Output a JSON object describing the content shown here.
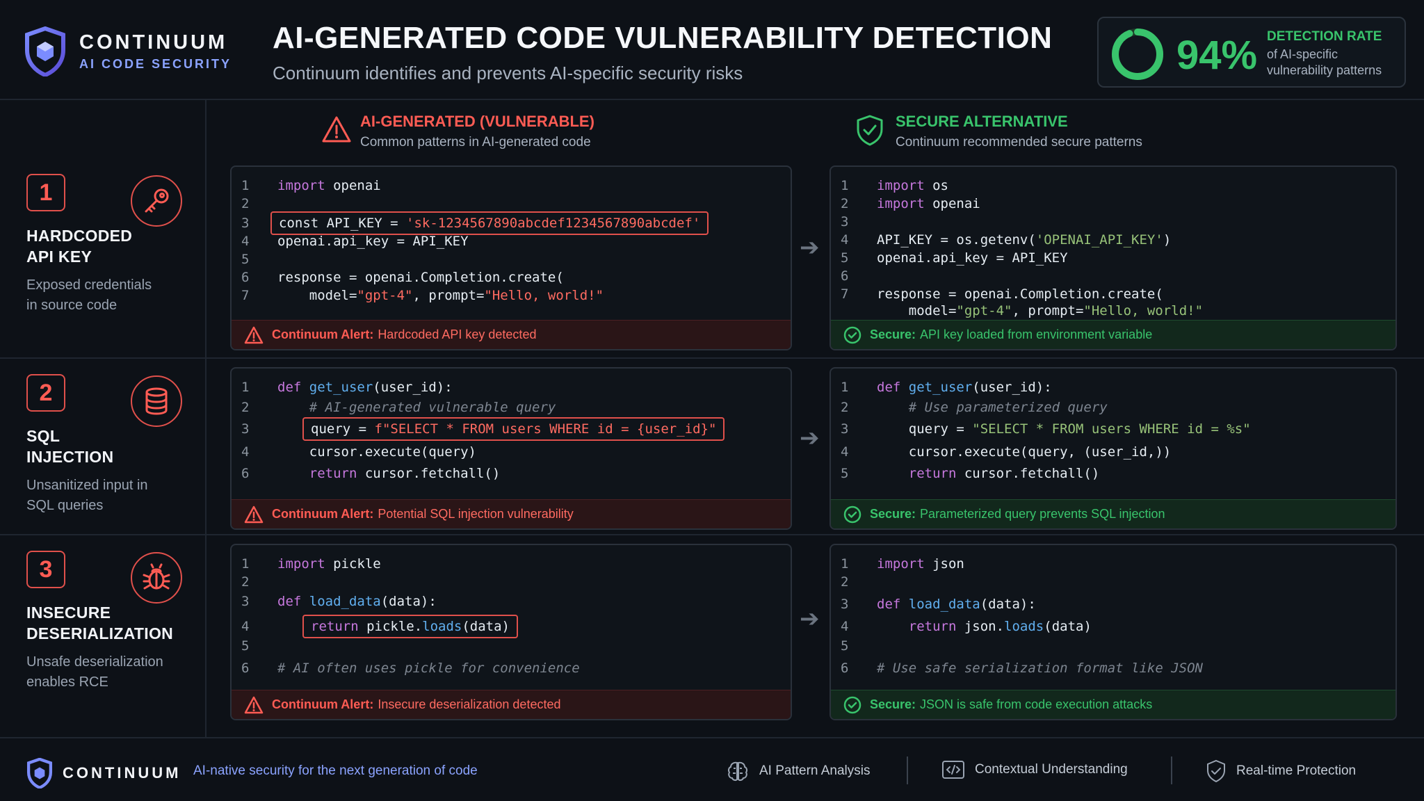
{
  "brand": {
    "name": "CONTINUUM",
    "tagline": "AI CODE SECURITY"
  },
  "header": {
    "title": "AI-GENERATED CODE VULNERABILITY DETECTION",
    "subtitle": "Continuum identifies and prevents AI-specific security risks"
  },
  "detection": {
    "value": "94%",
    "fraction": 0.94,
    "label": "DETECTION RATE",
    "description": "of AI-specific vulnerability patterns"
  },
  "columns": {
    "vulnerable": {
      "title": "AI-GENERATED (VULNERABLE)",
      "subtitle": "Common patterns in AI-generated code"
    },
    "secure": {
      "title": "SECURE ALTERNATIVE",
      "subtitle": "Continuum recommended secure patterns"
    }
  },
  "issues": [
    {
      "number": "1",
      "title_line1": "HARDCODED",
      "title_line2": "API KEY",
      "desc_line1": "Exposed credentials",
      "desc_line2": "in source code",
      "icon": "key-icon",
      "alert_label": "Continuum Alert:",
      "alert_message": "Hardcoded API key detected",
      "secure_label": "Secure:",
      "secure_message": "API key loaded from environment variable"
    },
    {
      "number": "2",
      "title_line1": "SQL",
      "title_line2": "INJECTION",
      "desc_line1": "Unsanitized input in",
      "desc_line2": "SQL queries",
      "icon": "database-icon",
      "alert_label": "Continuum Alert:",
      "alert_message": "Potential SQL injection vulnerability",
      "secure_label": "Secure:",
      "secure_message": "Parameterized query prevents SQL injection"
    },
    {
      "number": "3",
      "title_line1": "INSECURE",
      "title_line2": "DESERIALIZATION",
      "desc_line1": "Unsafe deserialization",
      "desc_line2": "enables RCE",
      "icon": "bug-icon",
      "alert_label": "Continuum Alert:",
      "alert_message": "Insecure deserialization detected",
      "secure_label": "Secure:",
      "secure_message": "JSON is safe from code execution attacks"
    }
  ],
  "code": {
    "v1": [
      {
        "n": "1",
        "parts": [
          [
            "kw",
            "import"
          ],
          [
            "",
            "openai"
          ]
        ]
      },
      {
        "n": "2",
        "parts": []
      },
      {
        "n": "3",
        "hl": true,
        "parts": [
          [
            "",
            "const API_KEY = "
          ],
          [
            "str-red",
            "'sk-1234567890abcdef1234567890abcdef'"
          ]
        ]
      },
      {
        "n": "4",
        "parts": [
          [
            "",
            "openai.api_key = API_KEY"
          ]
        ]
      },
      {
        "n": "5",
        "parts": []
      },
      {
        "n": "6",
        "parts": [
          [
            "",
            "response = openai.Completion.create("
          ]
        ]
      },
      {
        "n": "7",
        "parts": [
          [
            "",
            "    model="
          ],
          [
            "str-red",
            "\"gpt-4\""
          ],
          [
            "",
            ", prompt="
          ],
          [
            "str-red",
            "\"Hello, world!\""
          ]
        ]
      }
    ],
    "s1": [
      {
        "n": "1",
        "parts": [
          [
            "kw",
            "import"
          ],
          [
            "",
            "os"
          ]
        ]
      },
      {
        "n": "2",
        "parts": [
          [
            "kw",
            "import"
          ],
          [
            "",
            "openai"
          ]
        ]
      },
      {
        "n": "3",
        "parts": []
      },
      {
        "n": "4",
        "parts": [
          [
            "",
            "API_KEY = os.getenv("
          ],
          [
            "str-grn",
            "'OPENAI_API_KEY'"
          ],
          [
            "",
            ")"
          ]
        ]
      },
      {
        "n": "5",
        "parts": [
          [
            "",
            "openai.api_key = API_KEY"
          ]
        ]
      },
      {
        "n": "6",
        "parts": []
      },
      {
        "n": "7",
        "parts": [
          [
            "",
            "response = openai.Completion.create("
          ]
        ]
      },
      {
        "n": "",
        "parts": [
          [
            "",
            "    model="
          ],
          [
            "str-grn",
            "\"gpt-4\""
          ],
          [
            "",
            ", prompt="
          ],
          [
            "str-grn",
            "\"Hello, world!\""
          ]
        ]
      }
    ],
    "v2": [
      {
        "n": "1",
        "parts": [
          [
            "kw",
            "def"
          ],
          [
            "fn",
            "get_user"
          ],
          [
            "",
            "(user_id):"
          ]
        ]
      },
      {
        "n": "2",
        "parts": [
          [
            "cm",
            "    # AI-generated vulnerable query"
          ]
        ]
      },
      {
        "n": "3",
        "hl": true,
        "indent": true,
        "parts": [
          [
            "",
            "query = "
          ],
          [
            "str-red",
            "f\"SELECT * FROM users WHERE id = {user_id}\""
          ]
        ]
      },
      {
        "n": "4",
        "parts": [
          [
            "",
            "    cursor.execute(query)"
          ]
        ]
      },
      {
        "n": "6",
        "parts": [
          [
            "kw",
            "    return"
          ],
          [
            "",
            "cursor.fetchall()"
          ]
        ]
      }
    ],
    "s2": [
      {
        "n": "1",
        "parts": [
          [
            "kw",
            "def"
          ],
          [
            "fn",
            "get_user"
          ],
          [
            "",
            "(user_id):"
          ]
        ]
      },
      {
        "n": "2",
        "parts": [
          [
            "cm",
            "    # Use parameterized query"
          ]
        ]
      },
      {
        "n": "3",
        "parts": [
          [
            "",
            "    query = "
          ],
          [
            "str-grn",
            "\"SELECT * FROM users WHERE id = %s\""
          ]
        ]
      },
      {
        "n": "4",
        "parts": [
          [
            "",
            "    cursor.execute(query, (user_id,))"
          ]
        ]
      },
      {
        "n": "5",
        "parts": [
          [
            "kw",
            "    return"
          ],
          [
            "",
            "cursor.fetchall()"
          ]
        ]
      }
    ],
    "v3": [
      {
        "n": "1",
        "parts": [
          [
            "kw",
            "import"
          ],
          [
            "",
            "pickle"
          ]
        ]
      },
      {
        "n": "2",
        "parts": []
      },
      {
        "n": "3",
        "parts": [
          [
            "kw",
            "def"
          ],
          [
            "fn",
            "load_data"
          ],
          [
            "",
            "(data):"
          ]
        ]
      },
      {
        "n": "4",
        "hl": true,
        "indent": true,
        "parts": [
          [
            "kw",
            "return"
          ],
          [
            "",
            "pickle."
          ],
          [
            "fn",
            "loads"
          ],
          [
            "",
            "(data)"
          ]
        ]
      },
      {
        "n": "5",
        "parts": []
      },
      {
        "n": "6",
        "parts": [
          [
            "cm",
            "# AI often uses pickle for convenience"
          ]
        ]
      }
    ],
    "s3": [
      {
        "n": "1",
        "parts": [
          [
            "kw",
            "import"
          ],
          [
            "",
            "json"
          ]
        ]
      },
      {
        "n": "2",
        "parts": []
      },
      {
        "n": "3",
        "parts": [
          [
            "kw",
            "def"
          ],
          [
            "fn",
            "load_data"
          ],
          [
            "",
            "(data):"
          ]
        ]
      },
      {
        "n": "4",
        "parts": [
          [
            "kw",
            "    return"
          ],
          [
            "",
            "json."
          ],
          [
            "fn",
            "loads"
          ],
          [
            "",
            "(data)"
          ]
        ]
      },
      {
        "n": "5",
        "parts": []
      },
      {
        "n": "6",
        "parts": [
          [
            "cm",
            "# Use safe serialization format like JSON"
          ]
        ]
      }
    ]
  },
  "footer": {
    "brand": "CONTINUUM",
    "tagline": "AI-native security for the next generation of code",
    "features": [
      "AI Pattern Analysis",
      "Contextual Understanding",
      "Real-time Protection"
    ]
  },
  "colors": {
    "red": "#ff5c54",
    "green": "#39c46c",
    "accent": "#8ba3ff"
  }
}
